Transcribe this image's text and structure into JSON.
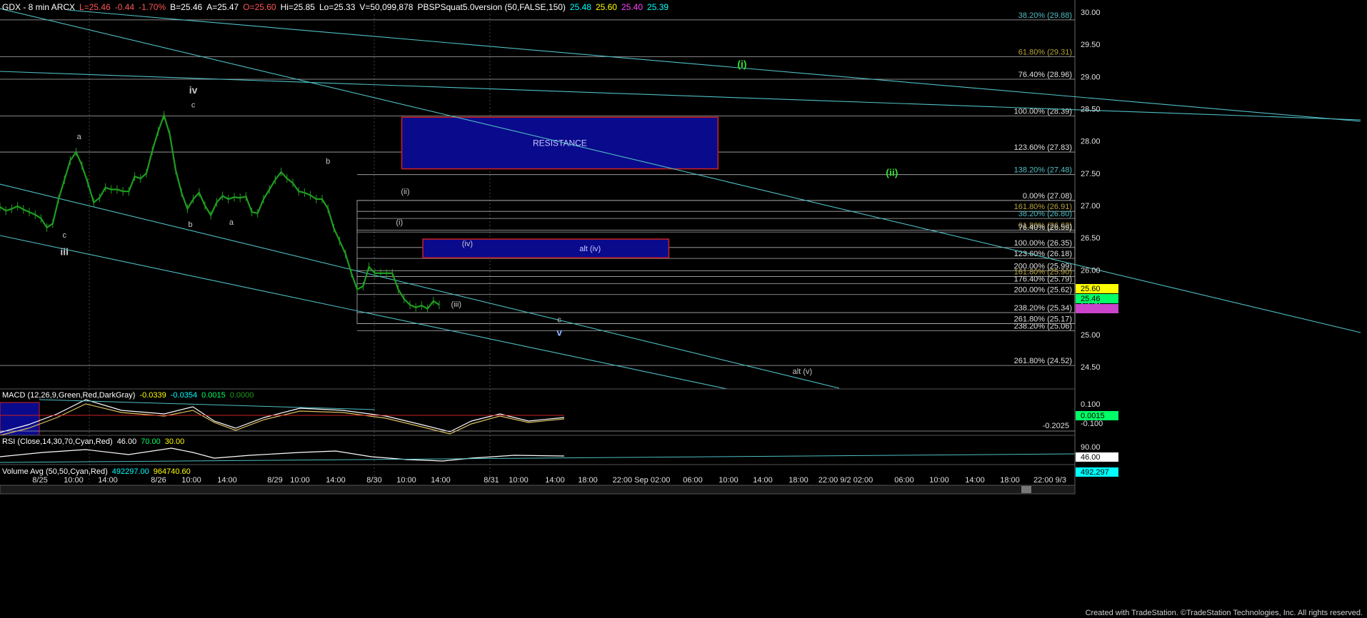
{
  "header": {
    "parts": [
      {
        "text": "GDX - 8 min  ARCX",
        "color": "#ffffff"
      },
      {
        "text": "L=25.46",
        "color": "#ff5555"
      },
      {
        "text": "-0.44",
        "color": "#ff5555"
      },
      {
        "text": "-1.70%",
        "color": "#ff5555"
      },
      {
        "text": "B=25.46",
        "color": "#ffffff"
      },
      {
        "text": "A=25.47",
        "color": "#ffffff"
      },
      {
        "text": "O=25.60",
        "color": "#ff5555"
      },
      {
        "text": "Hi=25.85",
        "color": "#ffffff"
      },
      {
        "text": "Lo=25.33",
        "color": "#ffffff"
      },
      {
        "text": "V=50,099,878",
        "color": "#ffffff"
      },
      {
        "text": "PBSPSquat5.0version (50,FALSE,150)",
        "color": "#ffffff"
      },
      {
        "text": "25.48",
        "color": "#00ffff"
      },
      {
        "text": "25.60",
        "color": "#ffff00"
      },
      {
        "text": "25.40",
        "color": "#ff44ff"
      },
      {
        "text": "25.39",
        "color": "#00ffff"
      }
    ]
  },
  "colors": {
    "background": "#000000",
    "bars": "#1f9d1f",
    "trend": "#4fbfc4",
    "level": "#c8c8c8",
    "fib_cyan": "#4fbfc4",
    "fib_gold": "#b8a23c",
    "fib_white": "#e0e0e0",
    "box_fill": "#0a0a8c",
    "box_border": "#cc2222",
    "wave_green": "#33dd33",
    "label": "#c8c8c8"
  },
  "chart_data": {
    "type": "line",
    "title": "GDX - 8 min",
    "ylim": [
      24.3,
      30.1
    ],
    "y_ticks": [
      "30.00",
      "29.50",
      "29.00",
      "28.50",
      "28.00",
      "27.50",
      "27.00",
      "26.50",
      "26.00",
      "25.50",
      "25.00",
      "24.50"
    ],
    "x_ticks": [
      "8/25",
      "10:00",
      "14:00",
      "8/26",
      "10:00",
      "14:00",
      "8/29",
      "10:00",
      "14:00",
      "8/30",
      "10:00",
      "14:00",
      "8/31",
      "10:00",
      "14:00",
      "18:00",
      "22:00 Sep 02:00",
      "06:00",
      "10:00",
      "14:00",
      "18:00",
      "22:00 9/2 02:00",
      "06:00",
      "10:00",
      "14:00",
      "18:00",
      "22:00 9/3"
    ],
    "price": [
      [
        0,
        26.98
      ],
      [
        1,
        26.92
      ],
      [
        2,
        26.95
      ],
      [
        3,
        26.99
      ],
      [
        4,
        26.94
      ],
      [
        5,
        26.9
      ],
      [
        6,
        26.86
      ],
      [
        7,
        26.8
      ],
      [
        8,
        26.66
      ],
      [
        9,
        26.72
      ],
      [
        10,
        27.1
      ],
      [
        11,
        27.4
      ],
      [
        12,
        27.7
      ],
      [
        13,
        27.83
      ],
      [
        14,
        27.62
      ],
      [
        15,
        27.35
      ],
      [
        16,
        27.05
      ],
      [
        17,
        27.12
      ],
      [
        18,
        27.28
      ],
      [
        19,
        27.25
      ],
      [
        20,
        27.25
      ],
      [
        21,
        27.22
      ],
      [
        22,
        27.22
      ],
      [
        23,
        27.45
      ],
      [
        24,
        27.42
      ],
      [
        25,
        27.5
      ],
      [
        26,
        27.85
      ],
      [
        27,
        28.15
      ],
      [
        28,
        28.4
      ],
      [
        29,
        28.1
      ],
      [
        30,
        27.55
      ],
      [
        31,
        27.2
      ],
      [
        32,
        26.95
      ],
      [
        33,
        27.1
      ],
      [
        34,
        27.2
      ],
      [
        35,
        27.0
      ],
      [
        36,
        26.85
      ],
      [
        37,
        27.05
      ],
      [
        38,
        27.15
      ],
      [
        39,
        27.1
      ],
      [
        40,
        27.13
      ],
      [
        41,
        27.12
      ],
      [
        42,
        27.14
      ],
      [
        43,
        26.9
      ],
      [
        44,
        26.88
      ],
      [
        45,
        27.1
      ],
      [
        46,
        27.25
      ],
      [
        47,
        27.4
      ],
      [
        48,
        27.52
      ],
      [
        49,
        27.42
      ],
      [
        50,
        27.35
      ],
      [
        51,
        27.22
      ],
      [
        52,
        27.2
      ],
      [
        53,
        27.16
      ],
      [
        54,
        27.1
      ],
      [
        55,
        27.1
      ],
      [
        56,
        26.95
      ],
      [
        57,
        26.65
      ],
      [
        58,
        26.45
      ],
      [
        59,
        26.25
      ],
      [
        60,
        25.95
      ],
      [
        61,
        25.7
      ],
      [
        62,
        25.75
      ],
      [
        63,
        26.05
      ],
      [
        64,
        25.95
      ],
      [
        65,
        25.95
      ],
      [
        66,
        25.95
      ],
      [
        67,
        25.95
      ],
      [
        68,
        25.7
      ],
      [
        69,
        25.55
      ],
      [
        70,
        25.46
      ],
      [
        71,
        25.42
      ],
      [
        72,
        25.45
      ],
      [
        73,
        25.4
      ],
      [
        74,
        25.52
      ],
      [
        75,
        25.46
      ]
    ],
    "price_right_labels": [
      {
        "value": "25.60",
        "color": "#ffff00",
        "text_color": "#000000"
      },
      {
        "value": "25.46",
        "color": "#00ff66",
        "text_color": "#000000"
      },
      {
        "value": "",
        "color": "#cc44cc",
        "text_color": "#000000"
      }
    ],
    "fib_levels": [
      {
        "label": "38.20% (29.88)",
        "value": 29.88,
        "color": "#4fbfc4"
      },
      {
        "label": "61.80% (29.31)",
        "value": 29.31,
        "color": "#b8a23c"
      },
      {
        "label": "76.40% (28.96)",
        "value": 28.96,
        "color": "#e0e0e0"
      },
      {
        "label": "100.00% (28.39)",
        "value": 28.39,
        "color": "#e0e0e0"
      },
      {
        "label": "123.60% (27.83)",
        "value": 27.83,
        "color": "#e0e0e0"
      },
      {
        "label": "138.20% (27.48)",
        "value": 27.48,
        "color": "#4fbfc4"
      },
      {
        "label": "0.00% (27.08)",
        "value": 27.08,
        "color": "#e0e0e0"
      },
      {
        "label": "161.80% (26.91)",
        "value": 26.91,
        "color": "#b8a23c"
      },
      {
        "label": "38.20% (26.80)",
        "value": 26.8,
        "color": "#4fbfc4"
      },
      {
        "label": "61.80% (26.62)",
        "value": 26.62,
        "color": "#b8a23c"
      },
      {
        "label": "76.40% (26.59)",
        "value": 26.59,
        "color": "#e0e0e0"
      },
      {
        "label": "100.00% (26.35)",
        "value": 26.35,
        "color": "#e0e0e0"
      },
      {
        "label": "123.60% (26.18)",
        "value": 26.18,
        "color": "#e0e0e0"
      },
      {
        "label": "200.00% (25.99)",
        "value": 25.99,
        "color": "#e0e0e0"
      },
      {
        "label": "161.80% (25.90)",
        "value": 25.9,
        "color": "#b8a23c"
      },
      {
        "label": "176.40% (25.79)",
        "value": 25.79,
        "color": "#e0e0e0"
      },
      {
        "label": "200.00% (25.62)",
        "value": 25.62,
        "color": "#e0e0e0"
      },
      {
        "label": "238.20% (25.34)",
        "value": 25.34,
        "color": "#e0e0e0"
      },
      {
        "label": "261.80% (25.17)",
        "value": 25.17,
        "color": "#e0e0e0"
      },
      {
        "label": "238.20% (25.06)",
        "value": 25.06,
        "color": "#e0e0e0"
      },
      {
        "label": "261.80% (24.52)",
        "value": 24.52,
        "color": "#e0e0e0"
      }
    ],
    "boxes": [
      {
        "label": "RESISTANCE",
        "x0": 68.6,
        "x1": 122.6,
        "y_top": 28.37,
        "y_bottom": 27.57
      },
      {
        "label": "alt (iv)",
        "x0": 72.2,
        "x1": 114.2,
        "y_top": 26.48,
        "y_bottom": 26.19
      }
    ],
    "wave_labels": [
      {
        "text": "iii",
        "x": 11,
        "y": 26.23,
        "color": "#c8c8c8",
        "bold": true
      },
      {
        "text": "c",
        "x": 11,
        "y": 26.5,
        "color": "#c8c8c8"
      },
      {
        "text": "a",
        "x": 13.5,
        "y": 28.03,
        "color": "#c8c8c8"
      },
      {
        "text": "iv",
        "x": 33,
        "y": 28.74,
        "color": "#c8c8c8",
        "bold": true
      },
      {
        "text": "c",
        "x": 33,
        "y": 28.52,
        "color": "#c8c8c8"
      },
      {
        "text": "b",
        "x": 32.5,
        "y": 26.67,
        "color": "#c8c8c8"
      },
      {
        "text": "a",
        "x": 39.5,
        "y": 26.7,
        "color": "#c8c8c8"
      },
      {
        "text": "b",
        "x": 56,
        "y": 27.65,
        "color": "#c8c8c8"
      },
      {
        "text": "(ii)",
        "x": 69.2,
        "y": 27.18,
        "color": "#c8c8c8"
      },
      {
        "text": "(i)",
        "x": 68.2,
        "y": 26.7,
        "color": "#c8c8c8"
      },
      {
        "text": "(iv)",
        "x": 79.8,
        "y": 26.37,
        "color": "#c8c8c8"
      },
      {
        "text": "(iii)",
        "x": 77.9,
        "y": 25.43,
        "color": "#c8c8c8"
      },
      {
        "text": "c",
        "x": 95.5,
        "y": 25.19,
        "color": "#c8c8c8"
      },
      {
        "text": "v",
        "x": 95.5,
        "y": 24.98,
        "color": "#8ab4ff",
        "bold": true
      },
      {
        "text": "(i)",
        "x": 126.7,
        "y": 29.14,
        "color": "#33dd33",
        "bold": true
      },
      {
        "text": "(ii)",
        "x": 152.3,
        "y": 27.46,
        "color": "#33dd33",
        "bold": true
      },
      {
        "text": "alt (v)",
        "x": 137,
        "y": 24.39,
        "color": "#c8c8c8"
      }
    ],
    "macd": {
      "title": "MACD (12,26,9,Green,Red,DarkGray)",
      "values": [
        {
          "text": "-0.0339",
          "color": "#ffff00"
        },
        {
          "text": "-0.0354",
          "color": "#00ffff"
        },
        {
          "text": "0.0015",
          "color": "#00ff66"
        },
        {
          "text": "0.0000",
          "color": "#1f9d1f"
        }
      ],
      "axis": [
        "0.100",
        "-0.100"
      ],
      "right_value": "0.0015",
      "extra_label": "-0.2025"
    },
    "rsi": {
      "title": "RSI (Close,14,30,70,Cyan,Red)",
      "values": [
        {
          "text": "46.00",
          "color": "#ffffff"
        },
        {
          "text": "70.00",
          "color": "#00ff66"
        },
        {
          "text": "30.00",
          "color": "#ffff00"
        }
      ],
      "axis": [
        "90.00"
      ],
      "right_value": "46.00"
    },
    "volume": {
      "title": "Volume Avg (50,50,Cyan,Red)",
      "values": [
        {
          "text": "492297.00",
          "color": "#00ffff"
        },
        {
          "text": "964740.60",
          "color": "#ffff00"
        }
      ],
      "right_value": "492,297"
    }
  },
  "footer": {
    "credit": "Created with TradeStation. ©TradeStation Technologies, Inc. All rights reserved."
  }
}
